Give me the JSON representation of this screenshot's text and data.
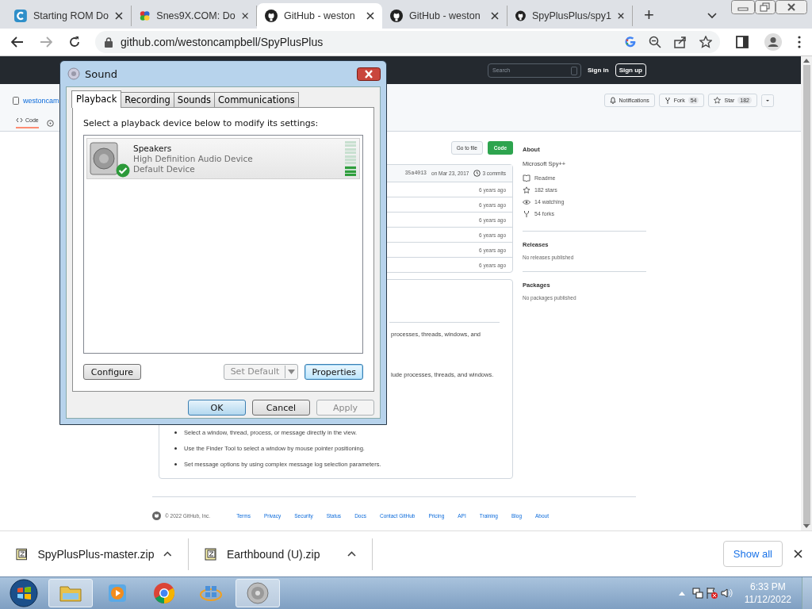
{
  "browser": {
    "tabs": [
      {
        "title": "Starting ROM Do",
        "selected": false
      },
      {
        "title": "Snes9X.COM: Do",
        "selected": false
      },
      {
        "title": "GitHub - weston",
        "selected": true
      },
      {
        "title": "GitHub - weston",
        "selected": false
      },
      {
        "title": "SpyPlusPlus/spy1",
        "selected": false
      }
    ],
    "new_tab": "+",
    "address": "github.com/westoncampbell/SpyPlusPlus"
  },
  "github": {
    "header": {
      "search_placeholder": "Search",
      "sign_in": "Sign in",
      "sign_up": "Sign up"
    },
    "repo": {
      "owner": "westoncam",
      "tabs": [
        "Code"
      ],
      "notifications": "Notifications",
      "fork": "Fork",
      "fork_count": "54",
      "star": "Star",
      "star_count": "182"
    },
    "files": {
      "go_to_file": "Go to file",
      "code": "Code",
      "commit_hash": "35a4013",
      "commit_date": "on Mar 23, 2017",
      "commits": "3 commits",
      "rows": [
        "6 years ago",
        "6 years ago",
        "6 years ago",
        "6 years ago",
        "6 years ago",
        "6 years ago"
      ]
    },
    "readme": {
      "fragments": [
        "processes, threads, windows, and",
        "lude processes, threads, and windows."
      ],
      "bullets": [
        "Select a window, thread, process, or message directly in the view.",
        "Use the Finder Tool to select a window by mouse pointer positioning.",
        "Set message options by using complex message log selection parameters."
      ]
    },
    "about": {
      "title": "About",
      "description": "Microsoft Spy++",
      "links": [
        {
          "kind": "book",
          "text": "Readme"
        },
        {
          "kind": "star",
          "text": "182 stars"
        },
        {
          "kind": "eye",
          "text": "14 watching"
        },
        {
          "kind": "fork",
          "text": "54 forks"
        }
      ],
      "sections": [
        {
          "title": "Releases",
          "note": "No releases published"
        },
        {
          "title": "Packages",
          "note": "No packages published"
        }
      ]
    },
    "footer": {
      "copyright": "© 2022 GitHub, Inc.",
      "links": [
        "Terms",
        "Privacy",
        "Security",
        "Status",
        "Docs",
        "Contact GitHub",
        "Pricing",
        "API",
        "Training",
        "Blog",
        "About"
      ]
    }
  },
  "downloads": {
    "items": [
      "SpyPlusPlus-master.zip",
      "Earthbound (U).zip"
    ],
    "show_all": "Show all"
  },
  "taskbar": {
    "apps": [
      {
        "kind": "explorer",
        "selected": true
      },
      {
        "kind": "media",
        "selected": false
      },
      {
        "kind": "chrome",
        "selected": false
      },
      {
        "kind": "windows",
        "selected": false
      },
      {
        "kind": "speaker",
        "selected": true
      }
    ],
    "time": "6:33 PM",
    "date": "11/12/2022"
  },
  "dialog": {
    "title": "Sound",
    "tabs": [
      {
        "label": "Playback",
        "selected": true
      },
      {
        "label": "Recording",
        "selected": false
      },
      {
        "label": "Sounds",
        "selected": false
      },
      {
        "label": "Communications",
        "selected": false
      }
    ],
    "instruction": "Select a playback device below to modify its settings:",
    "devices": [
      {
        "name": "Speakers",
        "description": "High Definition Audio Device",
        "status": "Default Device",
        "default": true
      }
    ],
    "configure": "Configure",
    "set_default": "Set Default",
    "properties": "Properties",
    "buttons": [
      {
        "label": "OK",
        "kind": "default"
      },
      {
        "label": "Cancel",
        "kind": "normal"
      },
      {
        "label": "Apply",
        "kind": "disabled"
      }
    ]
  }
}
